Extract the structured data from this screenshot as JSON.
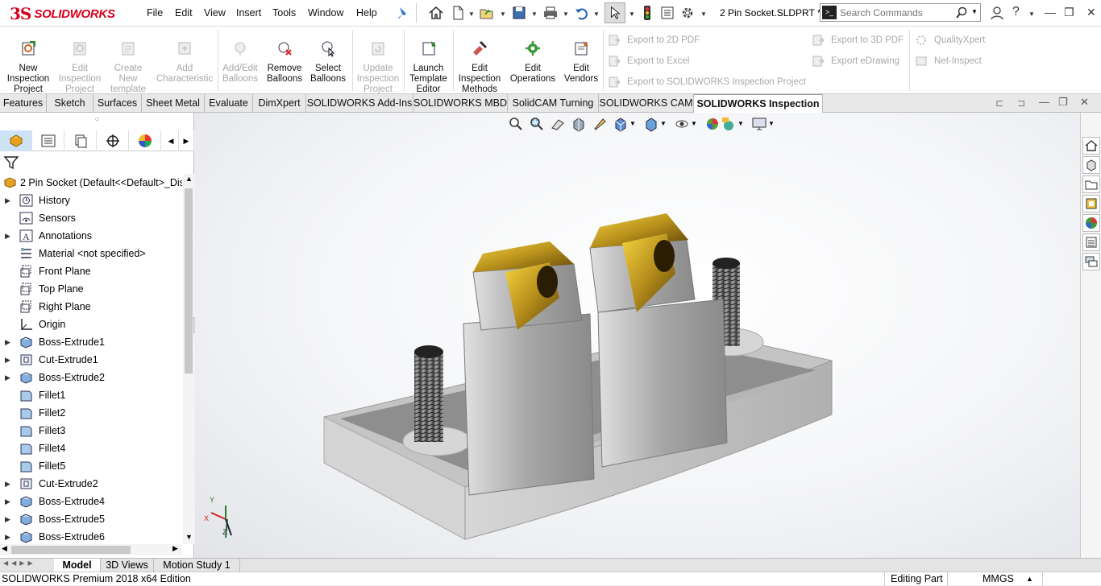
{
  "app": {
    "logo_ds": "3S",
    "logo_text": "SOLIDWORKS",
    "doc_title": "2 Pin Socket.SLDPRT *"
  },
  "menu": [
    "File",
    "Edit",
    "View",
    "Insert",
    "Tools",
    "Window",
    "Help"
  ],
  "search": {
    "placeholder": "Search Commands"
  },
  "ribbon": {
    "buttons": [
      {
        "label": "New\nInspection\nProject",
        "enabled": true
      },
      {
        "label": "Edit\nInspection\nProject",
        "enabled": false
      },
      {
        "label": "Create\nNew\ntemplate",
        "enabled": false
      },
      {
        "label": "Add\nCharacteristic",
        "enabled": false
      },
      {
        "label": "Add/Edit\nBalloons",
        "enabled": false
      },
      {
        "label": "Remove\nBalloons",
        "enabled": true
      },
      {
        "label": "Select\nBalloons",
        "enabled": true
      },
      {
        "label": "Update\nInspection\nProject",
        "enabled": false
      },
      {
        "label": "Launch\nTemplate\nEditor",
        "enabled": true
      },
      {
        "label": "Edit\nInspection\nMethods",
        "enabled": true
      },
      {
        "label": "Edit\nOperations",
        "enabled": true
      },
      {
        "label": "Edit\nVendors",
        "enabled": true
      }
    ],
    "export_items": [
      "Export to 2D PDF",
      "Export to Excel",
      "Export to SOLIDWORKS Inspection Project",
      "Export to 3D PDF",
      "Export eDrawing",
      "QualityXpert",
      "Net-Inspect"
    ]
  },
  "tabs": [
    "Features",
    "Sketch",
    "Surfaces",
    "Sheet Metal",
    "Evaluate",
    "DimXpert",
    "SOLIDWORKS Add-Ins",
    "SOLIDWORKS MBD",
    "SolidCAM Turning",
    "SOLIDWORKS CAM",
    "SOLIDWORKS Inspection"
  ],
  "active_tab": "SOLIDWORKS Inspection",
  "tree": {
    "root": "2 Pin Socket  (Default<<Default>_Disp",
    "items": [
      "History",
      "Sensors",
      "Annotations",
      "Material <not specified>",
      "Front Plane",
      "Top Plane",
      "Right Plane",
      "Origin",
      "Boss-Extrude1",
      "Cut-Extrude1",
      "Boss-Extrude2",
      "Fillet1",
      "Fillet2",
      "Fillet3",
      "Fillet4",
      "Fillet5",
      "Cut-Extrude2",
      "Boss-Extrude4",
      "Boss-Extrude5",
      "Boss-Extrude6"
    ]
  },
  "bottom_tabs": [
    "Model",
    "3D Views",
    "Motion Study 1"
  ],
  "status": {
    "left": "SOLIDWORKS Premium 2018 x64 Edition",
    "mode": "Editing Part",
    "units": "MMGS"
  },
  "colors": {
    "brand": "#d6001c",
    "viewport_bg": "#eef0f3"
  }
}
